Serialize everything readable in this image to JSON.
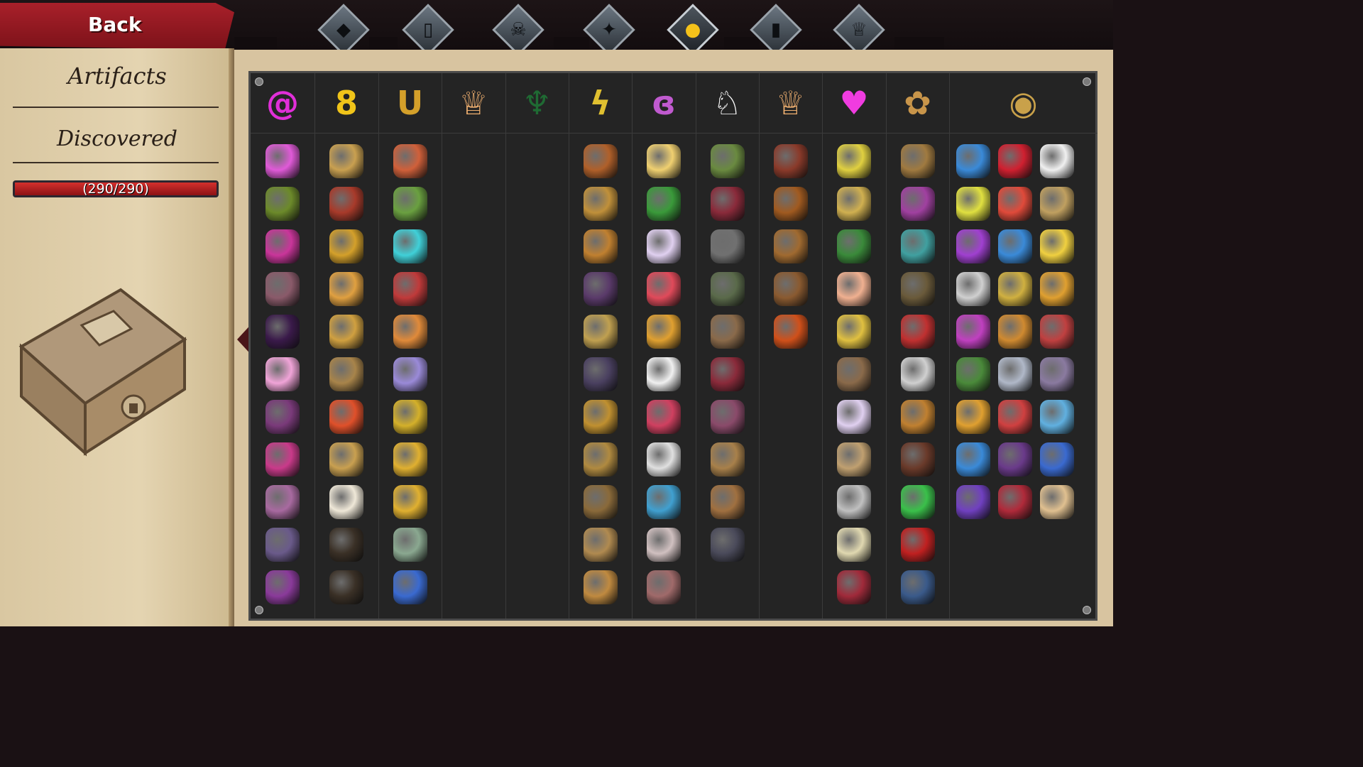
{
  "header": {
    "back_label": "Back"
  },
  "tabs": [
    {
      "name": "diamond",
      "glyph": "◆",
      "active": false
    },
    {
      "name": "card",
      "glyph": "▯",
      "active": false
    },
    {
      "name": "skull",
      "glyph": "☠",
      "active": false
    },
    {
      "name": "raven",
      "glyph": "✦",
      "active": false
    },
    {
      "name": "artifact",
      "glyph": "●",
      "active": true
    },
    {
      "name": "scroll",
      "glyph": "▮",
      "active": false
    },
    {
      "name": "trophy",
      "glyph": "♕",
      "active": false
    }
  ],
  "sidebar": {
    "title": "Artifacts",
    "subtitle": "Discovered",
    "progress_text": "(290/290)",
    "progress_fraction": 1.0
  },
  "columns": [
    {
      "name": "magenta-swirl",
      "symbol": "@",
      "color": "#e02fd8",
      "items": [
        "#e05ad8",
        "#6c8a2a",
        "#c9359a",
        "#8a5a6a",
        "#3a1a4a",
        "#f0a4d8",
        "#7a3a7a",
        "#c93a8a",
        "#a86aa0",
        "#6a5a8a",
        "#8a3a9a"
      ]
    },
    {
      "name": "gold-infinity",
      "symbol": "8",
      "color": "#f0c419",
      "items": [
        "#c9a050",
        "#a83a2a",
        "#d4a02a",
        "#e0a040",
        "#d0a040",
        "#a8844a",
        "#e0502a",
        "#c9a050",
        "#efe8d8",
        "#3a3026",
        "#3a3026"
      ]
    },
    {
      "name": "horseshoe",
      "symbol": "U",
      "color": "#d4a02a",
      "items": [
        "#d0603a",
        "#6aa040",
        "#40d0d8",
        "#c03a3a",
        "#e08a3a",
        "#9a8ad8",
        "#d4b02a",
        "#e0b030",
        "#e0b030",
        "#8aa890",
        "#3a6ad0"
      ]
    },
    {
      "name": "orange-crown",
      "symbol": "♕",
      "color": "#f0b070",
      "items": []
    },
    {
      "name": "green-sprout",
      "symbol": "♆",
      "color": "#1f6a33",
      "items": []
    },
    {
      "name": "gold-lightning",
      "symbol": "ϟ",
      "color": "#e0c030",
      "items": [
        "#b0602a",
        "#c0903a",
        "#c08030",
        "#5a3a6a",
        "#c0a050",
        "#4a4060",
        "#c09030",
        "#b08a40",
        "#8a6a3a",
        "#b08a50",
        "#c08a40"
      ]
    },
    {
      "name": "purple-curl",
      "symbol": "ɞ",
      "color": "#c05acf",
      "items": [
        "#f0d070",
        "#3a9a3a",
        "#e0d0f0",
        "#e04a5a",
        "#e0a030",
        "#f0f0f0",
        "#d04060",
        "#e0e0e0",
        "#40a0d0",
        "#d0c0c0",
        "#a06a6a"
      ]
    },
    {
      "name": "white-mask",
      "symbol": "♘",
      "color": "#ffffff",
      "items": [
        "#6a8a40",
        "#8a2a3a",
        "#707070",
        "#5a6a4a",
        "#8a6a4a",
        "#8a2a3a",
        "#8a4a6a",
        "#a8804a",
        "#a07040",
        "#4a4a5a"
      ]
    },
    {
      "name": "orange-crown-2",
      "symbol": "♕",
      "color": "#f0b070",
      "items": [
        "#8a3a2a",
        "#a05a20",
        "#a06a30",
        "#8a5a30",
        "#d0501a"
      ]
    },
    {
      "name": "pink-heart",
      "symbol": "♥",
      "color": "#f03ce0",
      "items": [
        "#e0d040",
        "#d0b050",
        "#3a8a3a",
        "#f0b090",
        "#e0c040",
        "#8a6a4a",
        "#e0d0f0",
        "#c0a070",
        "#c0c0c0",
        "#e0d8b0",
        "#a02a3a"
      ]
    },
    {
      "name": "bronze-coin",
      "symbol": "✿",
      "color": "#c8954a",
      "items": [
        "#a07a40",
        "#a040a0",
        "#40a0a0",
        "#6a5a3a",
        "#c03030",
        "#d0d0d0",
        "#c08030",
        "#6a3a2a",
        "#3ac04a",
        "#c02020",
        "#3a5a8a"
      ]
    },
    {
      "name": "golden-egg",
      "symbol": "◉",
      "color": "#c9a14a",
      "items": [
        "#3a8ad8",
        "#d02030",
        "#f0f0f0",
        "#e0e040",
        "#e04a3a",
        "#c0a060",
        "#a040d0",
        "#3a8ad8",
        "#f0d040",
        "#d0d0d0",
        "#d0b040",
        "#e0a030",
        "#c040c0",
        "#d08a30",
        "#c04040",
        "#4a8a3a",
        "#b0b8c8",
        "#8a7aa0",
        "#e0a030",
        "#d04040",
        "#60b0e0",
        "#3a8ad8",
        "#6a3a8a",
        "#3a6ad0",
        "#7040c0",
        "#b02a3a",
        "#e0c090"
      ]
    }
  ]
}
